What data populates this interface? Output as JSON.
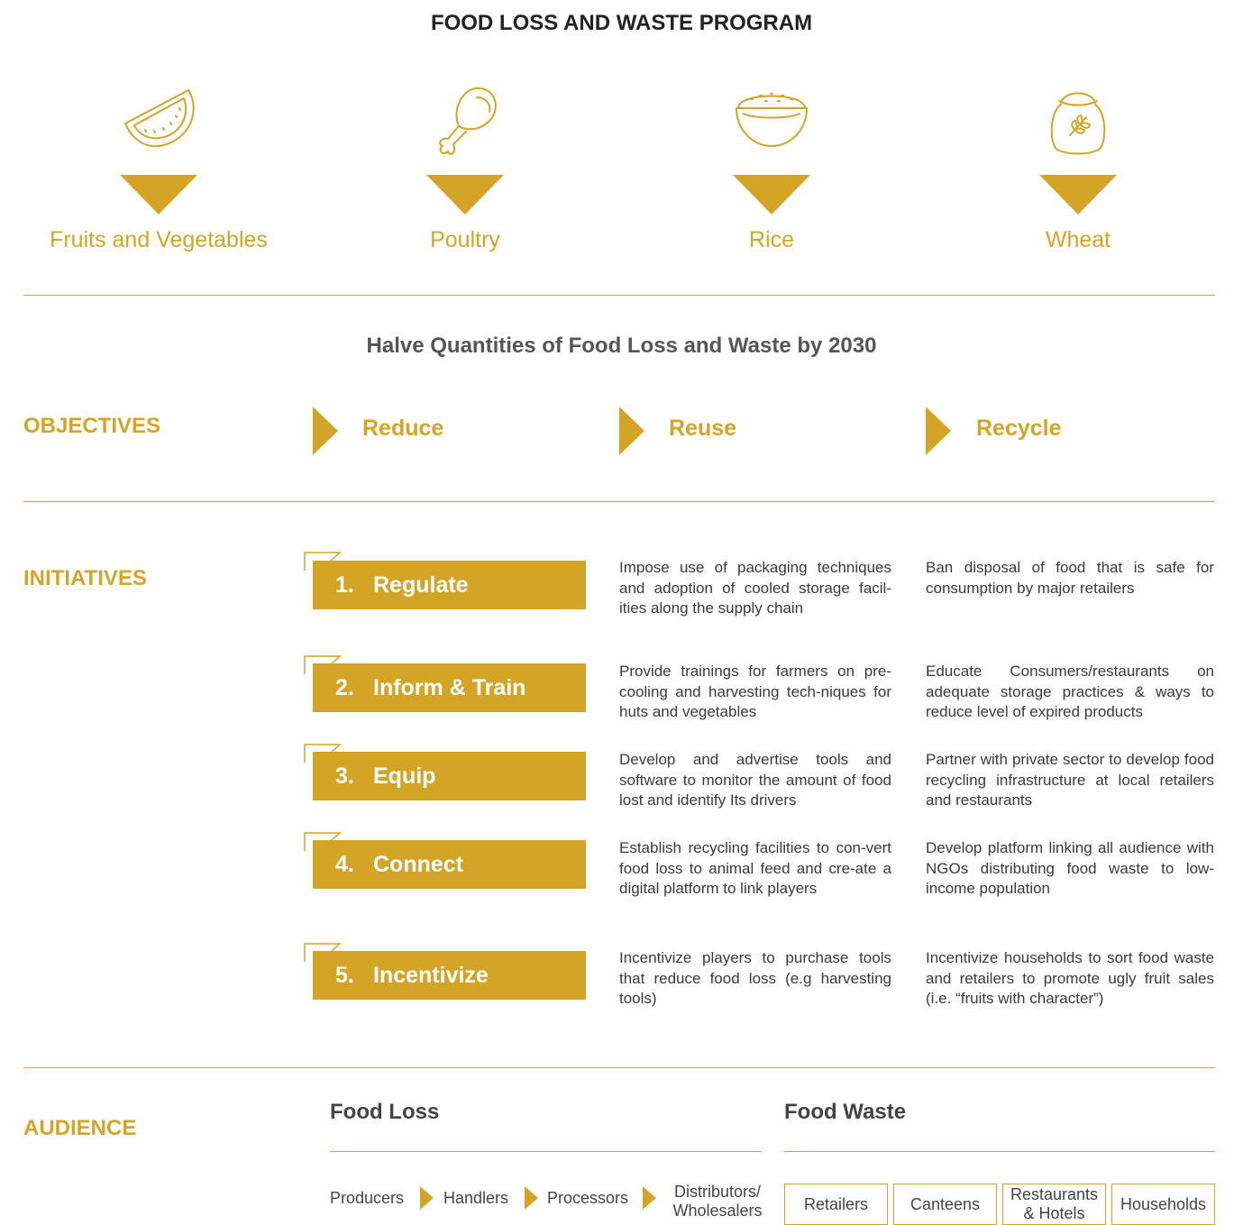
{
  "title": "FOOD LOSS AND WASTE PROGRAM",
  "products": [
    {
      "name": "Fruits and Vegetables",
      "icon": "watermelon-icon"
    },
    {
      "name": "Poultry",
      "icon": "chicken-leg-icon"
    },
    {
      "name": "Rice",
      "icon": "rice-bowl-icon"
    },
    {
      "name": "Wheat",
      "icon": "wheat-sack-icon"
    }
  ],
  "goal": "Halve Quantities of Food Loss and Waste by 2030",
  "objectives": {
    "label": "OBJECTIVES",
    "items": [
      "Reduce",
      "Reuse",
      "Recycle"
    ]
  },
  "initiatives": {
    "label": "INITIATIVES",
    "items": [
      {
        "num": "1.",
        "name": "Regulate",
        "loss": "Impose use of packaging techniques and adoption of cooled storage facil-ities along the supply chain",
        "waste": "Ban disposal of food that is safe for consumption by major retailers"
      },
      {
        "num": "2.",
        "name": "Inform & Train",
        "loss": "Provide trainings for farmers on pre-cooling and harvesting tech-niques for huts and vegetables",
        "waste": "Educate Consumers/restaurants on adequate storage practices & ways to reduce level of expired products"
      },
      {
        "num": "3.",
        "name": "Equip",
        "loss": "Develop and advertise tools and software to monitor the amount of food lost and identify Its drivers",
        "waste": "Partner with private sector to develop food recycling infrastructure at local retailers and restaurants"
      },
      {
        "num": "4.",
        "name": "Connect",
        "loss": "Establish recycling facilities to con-vert food loss to animal feed and cre-ate a digital platform to link players",
        "waste": "Develop platform linking all audience with NGOs distributing food waste to low-income population"
      },
      {
        "num": "5.",
        "name": "Incentivize",
        "loss": "Incentivize players to purchase tools that reduce food loss (e.g harvesting tools)",
        "waste": "Incentivize households to sort food waste and retailers to promote ugly fruit sales (i.e. “fruits with character”)"
      }
    ]
  },
  "audience": {
    "label": "AUDIENCE",
    "food_loss": {
      "title": "Food Loss",
      "chain": [
        "Producers",
        "Handlers",
        "Processors",
        "Distributors/ Wholesalers"
      ]
    },
    "food_waste": {
      "title": "Food Waste",
      "boxes": [
        "Retailers",
        "Canteens",
        "Restaurants & Hotels",
        "Households"
      ]
    }
  },
  "colors": {
    "accent": "#D4A427",
    "text": "#3a3a3a"
  }
}
